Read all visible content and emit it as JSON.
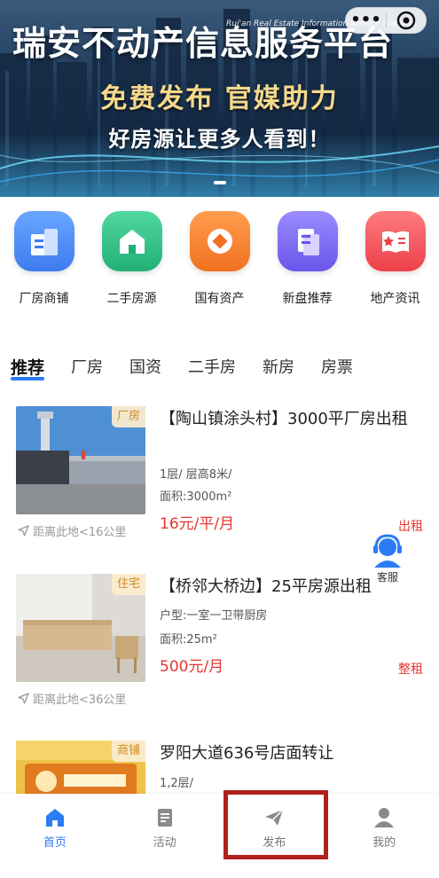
{
  "banner": {
    "title": "瑞安不动产信息服务平台",
    "subtitle_en": "Rui'an Real Estate Information Service Platform",
    "slogan_line1": "免费发布 官媒助力",
    "slogan_line2": "好房源让更多人看到！",
    "capsule_more": "•••",
    "carousel_active_index": 0
  },
  "categories": [
    {
      "label": "厂房商铺",
      "icon": "building-icon",
      "color": "#4a8df5"
    },
    {
      "label": "二手房源",
      "icon": "house-icon",
      "color": "#2fbf86"
    },
    {
      "label": "国有资产",
      "icon": "coin-icon",
      "color": "#f5812d"
    },
    {
      "label": "新盘推荐",
      "icon": "document-icon",
      "color": "#7b6af0"
    },
    {
      "label": "地产资讯",
      "icon": "news-book-icon",
      "color": "#f2555a"
    }
  ],
  "tabs": [
    {
      "label": "推荐",
      "active": true
    },
    {
      "label": "厂房",
      "active": false
    },
    {
      "label": "国资",
      "active": false
    },
    {
      "label": "二手房",
      "active": false
    },
    {
      "label": "新房",
      "active": false
    },
    {
      "label": "房票",
      "active": false
    }
  ],
  "listings": [
    {
      "badge": "厂房",
      "title": "【陶山镇涂头村】3000平厂房出租",
      "meta1": "1层/ 层高8米/",
      "meta2": "面积:3000m²",
      "price": "16元/平/月",
      "rent_type": "出租",
      "distance": "距离此地<16公里"
    },
    {
      "badge": "住宅",
      "title": "【桥邻大桥边】25平房源出租",
      "meta1": "户型:一室一卫带厨房",
      "meta2": "面积:25m²",
      "price": "500元/月",
      "rent_type": "整租",
      "distance": "距离此地<36公里"
    },
    {
      "badge": "商铺",
      "title": "罗阳大道636号店面转让",
      "meta1": "1,2层/",
      "meta2": "",
      "price": "",
      "rent_type": "",
      "distance": ""
    }
  ],
  "customer_service": {
    "label": "客服"
  },
  "bottom_nav": [
    {
      "label": "首页",
      "icon": "home-icon",
      "active": true
    },
    {
      "label": "活动",
      "icon": "activity-icon",
      "active": false
    },
    {
      "label": "发布",
      "icon": "send-icon",
      "active": false
    },
    {
      "label": "我的",
      "icon": "user-icon",
      "active": false
    }
  ],
  "colors": {
    "accent": "#2b7cf6",
    "price": "#e5352f",
    "badge_text": "#d08a22",
    "highlight": "#b0211c"
  }
}
